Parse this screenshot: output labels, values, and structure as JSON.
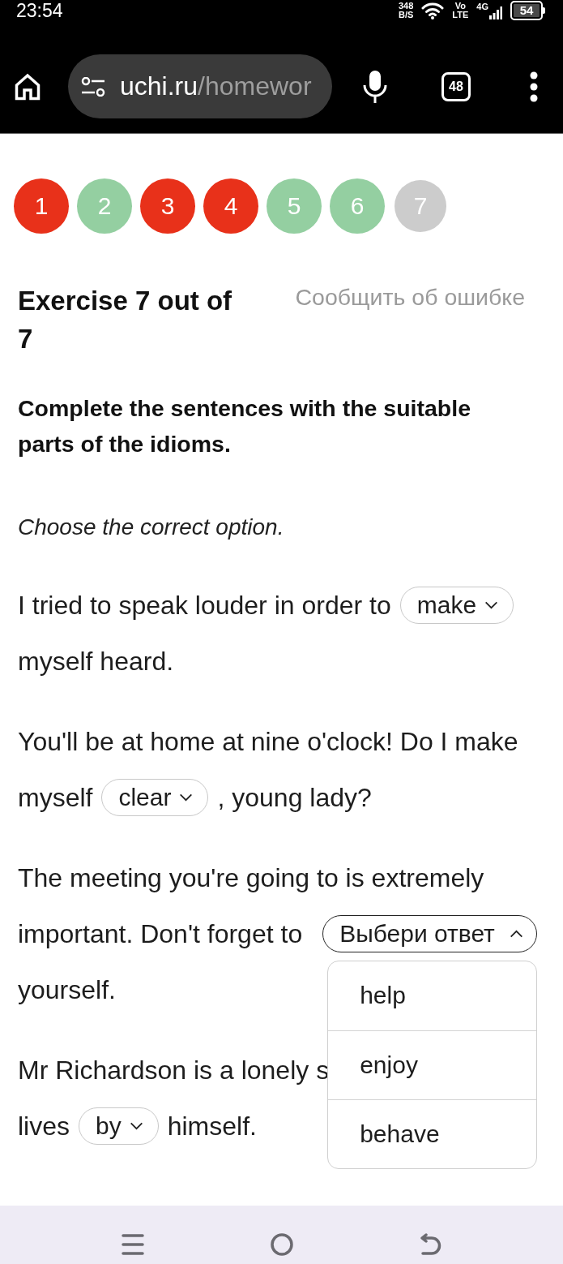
{
  "status_bar": {
    "time": "23:54",
    "speed_value": "348",
    "speed_unit": "B/S",
    "volte_top": "Vo",
    "volte_bottom": "LTE",
    "network": "4G",
    "battery": "54"
  },
  "browser": {
    "url": {
      "domain": "uchi.ru",
      "path": "/homewor"
    },
    "tab_count": "48"
  },
  "steps": [
    {
      "label": "1",
      "color": "#e8311a",
      "selected": false
    },
    {
      "label": "2",
      "color": "#94cfa1",
      "selected": false
    },
    {
      "label": "3",
      "color": "#e8311a",
      "selected": false
    },
    {
      "label": "4",
      "color": "#e8311a",
      "selected": false
    },
    {
      "label": "5",
      "color": "#94cfa1",
      "selected": false
    },
    {
      "label": "6",
      "color": "#94cfa1",
      "selected": false
    },
    {
      "label": "7",
      "color": "#cccccc",
      "selected": true
    }
  ],
  "exercise": {
    "title": "Exercise 7 out of 7",
    "report_link": "Сообщить об ошибке",
    "instruction": "Complete the sentences with the suitable parts of the idioms.",
    "hint": "Choose the correct option.",
    "sentences": [
      {
        "lines": [
          [
            {
              "kind": "text",
              "text": "I tried to speak louder in order to"
            },
            {
              "kind": "select",
              "value": "make",
              "expanded": false
            }
          ],
          [
            {
              "kind": "text",
              "text": "myself heard."
            }
          ]
        ]
      },
      {
        "lines": [
          [
            {
              "kind": "text",
              "text": "You'll be at home at nine o'clock! Do I make"
            }
          ],
          [
            {
              "kind": "text",
              "text": "myself"
            },
            {
              "kind": "select",
              "value": "clear",
              "expanded": false
            },
            {
              "kind": "text",
              "text": ", young lady?"
            }
          ]
        ]
      },
      {
        "lines": [
          [
            {
              "kind": "text",
              "text": "The meeting you're going to is extremely"
            }
          ],
          [
            {
              "kind": "text",
              "text": "important. Don't forget to"
            },
            {
              "kind": "select",
              "placeholder": "Выбери ответ",
              "expanded": true,
              "options": [
                {
                  "label": "help",
                  "selected": false
                },
                {
                  "label": "enjoy",
                  "selected": false
                },
                {
                  "label": "behave",
                  "selected": false
                }
              ]
            }
          ],
          [
            {
              "kind": "text",
              "text": "yourself."
            }
          ]
        ]
      },
      {
        "lines": [
          [
            {
              "kind": "text",
              "text": "Mr Richardson is a lonely s"
            }
          ],
          [
            {
              "kind": "text",
              "text": "lives"
            },
            {
              "kind": "select",
              "value": "by",
              "expanded": false
            },
            {
              "kind": "text",
              "text": "himself."
            }
          ]
        ]
      }
    ]
  }
}
